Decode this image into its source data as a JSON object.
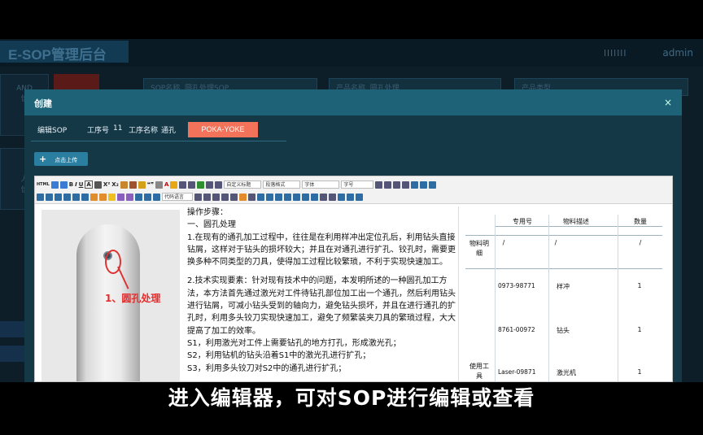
{
  "background_app": {
    "title": "E-SOP管理后台",
    "user": "admin",
    "signal": "lllllll",
    "filters": [
      {
        "label": "SOP名称",
        "value": "圆孔处理SOP"
      },
      {
        "label": "产品名称",
        "value": "圆孔处理"
      },
      {
        "label": "产品类型",
        "value": ""
      }
    ],
    "cards": [
      {
        "line1": "AND",
        "line2": "信"
      },
      {
        "line1": "人",
        "line2": "信"
      }
    ]
  },
  "modal": {
    "title": "创建",
    "close": "×",
    "edit_sop_label": "编辑SOP",
    "step_no_label": "工序号",
    "step_no_value": "11",
    "step_name_label": "工序名称",
    "step_name_value": "通孔",
    "poka_yoke": "POKA-YOKE",
    "upload_label": "点击上传",
    "upload_plus": "+"
  },
  "toolbar": {
    "html_label": "HTML",
    "bold": "B",
    "italic": "I",
    "underline": "U",
    "letter_a": "A",
    "superscript": "X²",
    "subscript": "X₂",
    "quote": "❝❞",
    "font_color": "A",
    "selects": [
      "自定义标题",
      "段落格式",
      "字体",
      "字号"
    ],
    "code_lang": "代码语言"
  },
  "content": {
    "photo_label": "1、圆孔处理",
    "paragraphs": [
      "操作步骤：",
      "一、圆孔处理",
      "1.在现有的通孔加工过程中，往往是在利用样冲出定位孔后，利用钻头直接钻屑，这样对于钻头的损坏较大；并且在对通孔进行扩孔、铰孔时，需要更换多种不同类型的刀具，使得加工过程比较繁琐，不利于实现快速加工。",
      "2.技术实现要素：针对现有技术中的问题，本发明所述的一种圆孔加工方法，本方法首先通过激光对工件待钻孔部位加工出一个通孔，然后利用钻头进行钻屑，可减小钻头受到的轴向力，避免钻头损坏，并且在进行通孔的扩孔时，利用多头铰刀实现快速加工，避免了频繁装夹刀具的繁琐过程，大大提高了加工的效率。",
      "S1，利用激光对工件上需要钻孔的地方打孔，形成激光孔；",
      "S2，利用钻机的钻头沿着S1中的激光孔进行扩孔；",
      "S3，利用多头铰刀对S2中的通孔进行扩孔；"
    ],
    "table": {
      "headers": [
        "专用号",
        "物料描述",
        "数量"
      ],
      "group1_label": "物料明细",
      "group1_row": [
        "/",
        "/",
        "/"
      ],
      "group2_label": "使用工具",
      "rows": [
        [
          "0973-98771",
          "样冲",
          "1"
        ],
        [
          "8761-00972",
          "钻头",
          "1"
        ],
        [
          "Laser-09871",
          "激光机",
          "1"
        ]
      ]
    }
  },
  "caption": "进入编辑器，可对SOP进行编辑或查看"
}
